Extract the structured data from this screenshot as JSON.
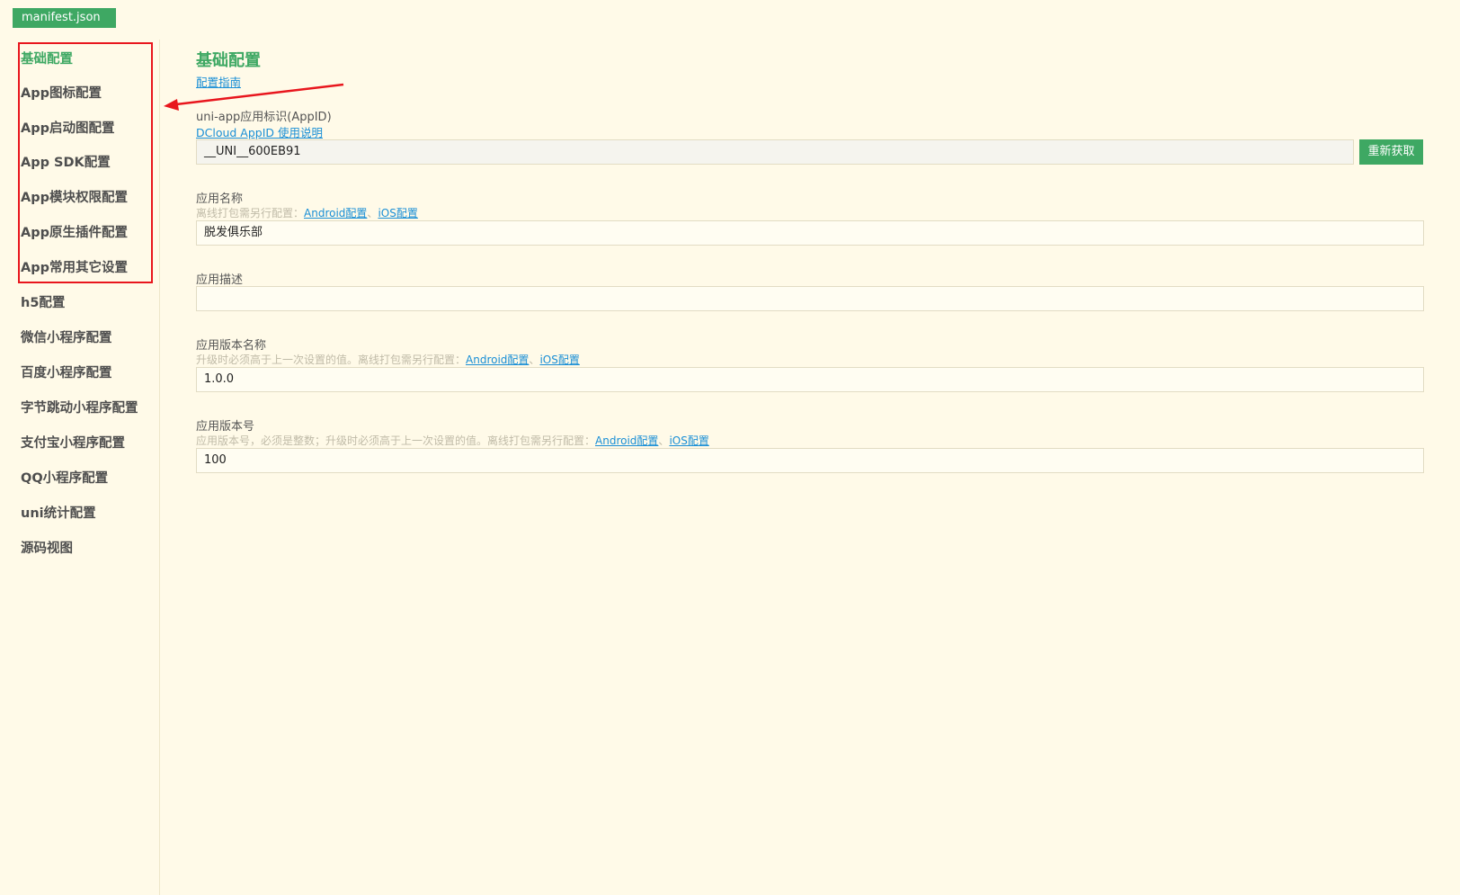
{
  "file_tab": {
    "label": "manifest.json"
  },
  "sidebar": {
    "items": [
      {
        "label": "基础配置"
      },
      {
        "label": "App图标配置"
      },
      {
        "label": "App启动图配置"
      },
      {
        "label": "App SDK配置"
      },
      {
        "label": "App模块权限配置"
      },
      {
        "label": "App原生插件配置"
      },
      {
        "label": "App常用其它设置"
      },
      {
        "label": "h5配置"
      },
      {
        "label": "微信小程序配置"
      },
      {
        "label": "百度小程序配置"
      },
      {
        "label": "字节跳动小程序配置"
      },
      {
        "label": "支付宝小程序配置"
      },
      {
        "label": "QQ小程序配置"
      },
      {
        "label": "uni统计配置"
      },
      {
        "label": "源码视图"
      }
    ],
    "active_index": 0
  },
  "main": {
    "title": "基础配置",
    "guide_link": "配置指南",
    "appid": {
      "label": "uni-app应用标识(AppID)",
      "help_link": "DCloud AppID 使用说明",
      "value": "__UNI__600EB91",
      "refresh_button": "重新获取"
    },
    "app_name": {
      "label": "应用名称",
      "hint": "离线打包需另行配置：",
      "android_link": "Android配置",
      "separator": "、",
      "ios_link": "iOS配置",
      "value": "脱发俱乐部"
    },
    "app_desc": {
      "label": "应用描述",
      "value": ""
    },
    "version_name": {
      "label": "应用版本名称",
      "hint": "升级时必须高于上一次设置的值。离线打包需另行配置：",
      "android_link": "Android配置",
      "separator": "、",
      "ios_link": "iOS配置",
      "value": "1.0.0"
    },
    "version_code": {
      "label": "应用版本号",
      "hint": "应用版本号，必须是整数；升级时必须高于上一次设置的值。离线打包需另行配置：",
      "android_link": "Android配置",
      "separator": "、",
      "ios_link": "iOS配置",
      "value": "100"
    }
  },
  "colors": {
    "background": "#fffae8",
    "accent": "#3ea863",
    "link": "#1a8fd6",
    "annotation": "#e8161d"
  }
}
